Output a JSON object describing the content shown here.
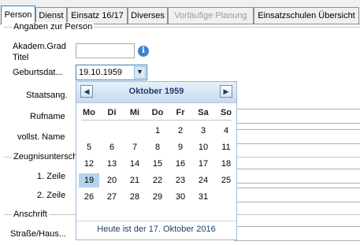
{
  "tabs": [
    {
      "label": "Person"
    },
    {
      "label": "Dienst"
    },
    {
      "label": "Einsatz 16/17"
    },
    {
      "label": "Diverses"
    },
    {
      "label": "Vorläufige Planung"
    },
    {
      "label": "Einsatzschulen Übersicht"
    }
  ],
  "groups": {
    "person": "Angaben zur Person",
    "zeugnis": "Zeugnisunterschr",
    "anschrift": "Anschrift"
  },
  "labels": {
    "akadem": "Akadem.Grad",
    "titel": "Titel",
    "geburtsdatum": "Geburtsdat...",
    "staatsang": "Staatsang.",
    "rufname": "Rufname",
    "vollst_name": "vollst. Name",
    "zeile1": "1. Zeile",
    "zeile2": "2. Zeile",
    "strasse": "Straße/Haus..."
  },
  "fields": {
    "akadem_value": "",
    "geburtsdatum_value": "19.10.1959"
  },
  "info_icon_glyph": "i",
  "calendar": {
    "month_label": "Oktober 1959",
    "prev_glyph": "◀",
    "next_glyph": "▶",
    "weekdays": [
      "Mo",
      "Di",
      "Mi",
      "Do",
      "Fr",
      "Sa",
      "So"
    ],
    "rows": [
      [
        "",
        "",
        "",
        "1",
        "2",
        "3",
        "4"
      ],
      [
        "5",
        "6",
        "7",
        "8",
        "9",
        "10",
        "11"
      ],
      [
        "12",
        "13",
        "14",
        "15",
        "16",
        "17",
        "18"
      ],
      [
        "19",
        "20",
        "21",
        "22",
        "23",
        "24",
        "25"
      ],
      [
        "26",
        "27",
        "28",
        "29",
        "30",
        "31",
        ""
      ]
    ],
    "selected_day": "19",
    "today_text": "Heute ist der 17. Oktober 2016"
  },
  "colors": {
    "accent": "#3c7fb1",
    "selected_day": "#b4d3ee",
    "calendar_header": "#c7dbf0"
  }
}
